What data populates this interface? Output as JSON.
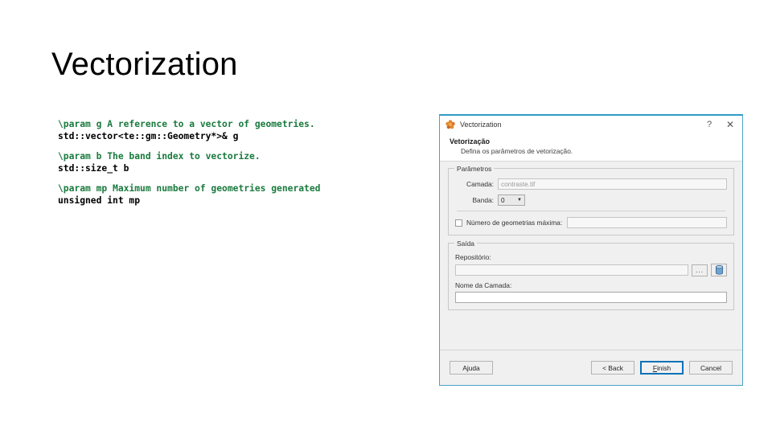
{
  "slide": {
    "title": "Vectorization"
  },
  "code": {
    "groups": [
      {
        "doc": "\\param g A reference to a vector of geometries.",
        "decl": "std::vector<te::gm::Geometry*>& g"
      },
      {
        "doc": "\\param b The band index to vectorize.",
        "decl": "std::size_t b"
      },
      {
        "doc": "\\param mp Maximum number of geometries generated",
        "decl": "unsigned int mp"
      }
    ],
    "doc_color": "#1a7a3e",
    "decl_color": "#000000"
  },
  "dialog": {
    "titlebar": {
      "icon": "terralib-flower-icon",
      "title": "Vectorization",
      "help_label": "?",
      "close_label": "✕"
    },
    "header": {
      "title": "Vetorização",
      "subtitle": "Defina os parâmetros de vetorização."
    },
    "parameters": {
      "group_label": "Parâmetros",
      "layer_label": "Camada:",
      "layer_value": "contraste.tif",
      "band_label": "Banda:",
      "band_value": "0",
      "band_arrow": "▼",
      "max_geom_label": "Número de geometrias máxima:",
      "max_geom_value": "",
      "max_geom_checked": false
    },
    "output": {
      "group_label": "Saída",
      "repository_label": "Repositório:",
      "repository_value": "",
      "browse_label": "...",
      "database_icon": "database-icon",
      "layer_name_label": "Nome da Camada:",
      "layer_name_value": ""
    },
    "footer": {
      "help_button": "Ajuda",
      "back_button": "< Back",
      "finish_button_prefix": "",
      "finish_button_accel": "F",
      "finish_button_suffix": "inish",
      "cancel_button": "Cancel"
    },
    "colors": {
      "accent_border": "#2f9cc4",
      "default_button_border": "#0a72b7",
      "background": "#f0f0f0"
    }
  }
}
